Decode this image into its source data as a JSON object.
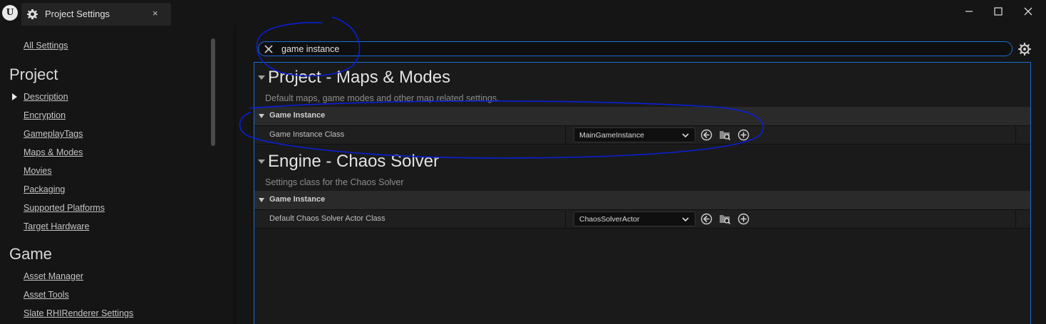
{
  "titlebar": {
    "tab_title": "Project Settings",
    "close_glyph": "×",
    "minimize_glyph": "—",
    "maximize_glyph": "☐",
    "window_close_glyph": "✕",
    "logo_text": "U"
  },
  "sidebar": {
    "all_settings": "All Settings",
    "project_heading": "Project",
    "project_items": [
      "Description",
      "Encryption",
      "GameplayTags",
      "Maps & Modes",
      "Movies",
      "Packaging",
      "Supported Platforms",
      "Target Hardware"
    ],
    "game_heading": "Game",
    "game_items": [
      "Asset Manager",
      "Asset Tools",
      "Slate RHIRenderer Settings"
    ]
  },
  "search": {
    "value": "game instance"
  },
  "categories": [
    {
      "title": "Project - Maps & Modes",
      "description": "Default maps, game modes and other map related settings.",
      "section": "Game Instance",
      "property": "Game Instance Class",
      "value": "MainGameInstance"
    },
    {
      "title": "Engine - Chaos Solver",
      "description": "Settings class for the Chaos Solver",
      "section": "Game Instance",
      "property": "Default Chaos Solver Actor Class",
      "value": "ChaosSolverActor"
    }
  ],
  "colors": {
    "background": "#151515",
    "panel": "#1a1a1a",
    "accent_blue": "#1a6fd1",
    "annotation_ink": "#0a1fd8"
  },
  "icons": [
    "unreal-logo-icon",
    "settings-tab-icon",
    "clear-search-icon",
    "gear-icon",
    "chevron-down-icon",
    "use-selected-icon",
    "browse-icon",
    "add-icon"
  ]
}
